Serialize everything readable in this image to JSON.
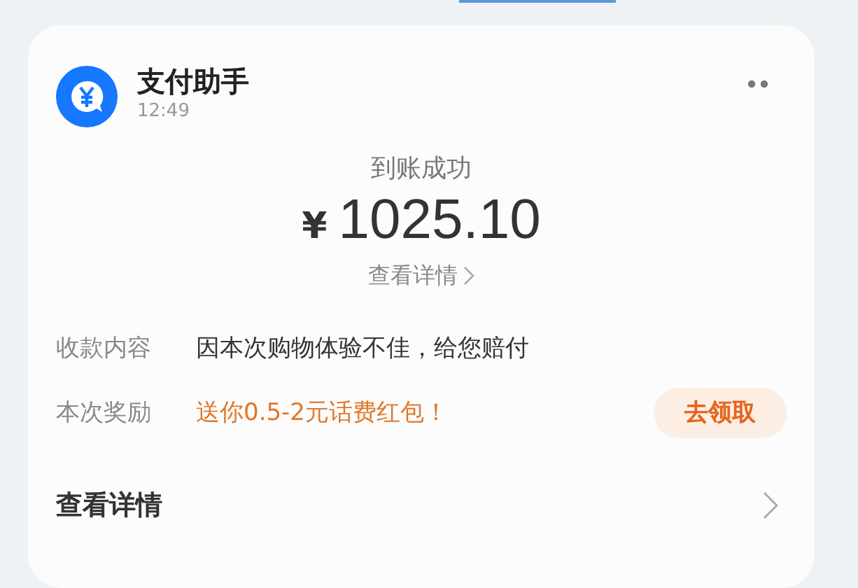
{
  "notification": {
    "app_name": "支付助手",
    "time": "12:49"
  },
  "status": "到账成功",
  "amount": {
    "currency": "¥",
    "value": "1025.10"
  },
  "detail_link": "查看详情",
  "rows": [
    {
      "kind": "plain",
      "label": "收款内容",
      "value": "因本次购物体验不佳，给您赔付"
    },
    {
      "kind": "reward",
      "label": "本次奖励",
      "value": "送你0.5-2元话费红包！",
      "button": "去领取"
    }
  ],
  "footer": {
    "label": "查看详情"
  }
}
